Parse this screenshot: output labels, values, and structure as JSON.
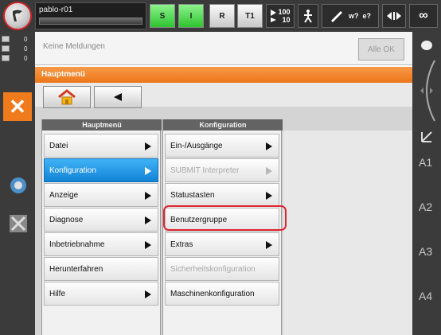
{
  "topbar": {
    "robot_name": "pablo-r01",
    "btn_s": "S",
    "btn_i": "I",
    "btn_r": "R",
    "mode": "T1",
    "override_prog": "100",
    "override_jog": "10",
    "tool_label": "w?  e?",
    "infinity": "∞"
  },
  "left": {
    "rows": [
      "0",
      "0",
      "0"
    ]
  },
  "messages": {
    "text": "Keine Meldungen",
    "ack_all": "Alle OK"
  },
  "window": {
    "title": "Hauptmenü"
  },
  "columns": {
    "main": {
      "header": "Hauptmenü",
      "items": [
        {
          "label": "Datei"
        },
        {
          "label": "Konfiguration"
        },
        {
          "label": "Anzeige"
        },
        {
          "label": "Diagnose"
        },
        {
          "label": "Inbetriebnahme"
        },
        {
          "label": "Herunterfahren"
        },
        {
          "label": "Hilfe"
        }
      ]
    },
    "config": {
      "header": "Konfiguration",
      "items": [
        {
          "label": "Ein-/Ausgänge"
        },
        {
          "label": "SUBMIT Interpreter"
        },
        {
          "label": "Statustasten"
        },
        {
          "label": "Benutzergruppe"
        },
        {
          "label": "Extras"
        },
        {
          "label": "Sicherheitskonfiguration"
        },
        {
          "label": "Maschinenkonfiguration"
        }
      ]
    }
  },
  "right": {
    "axes": [
      "A1",
      "A2",
      "A3",
      "A4"
    ]
  },
  "colors": {
    "accent_orange": "#ec7618",
    "selected_blue": "#1383d6",
    "highlight_red": "#e0262f",
    "status_green": "#2fc42f"
  },
  "icons": {
    "logo": "kuka-hmi-logo-icon",
    "home": "home-icon",
    "back": "back-arrow-icon",
    "close": "close-icon",
    "robot": "robot-icon",
    "tool": "tool-icon",
    "walk": "jog-mode-icon"
  }
}
